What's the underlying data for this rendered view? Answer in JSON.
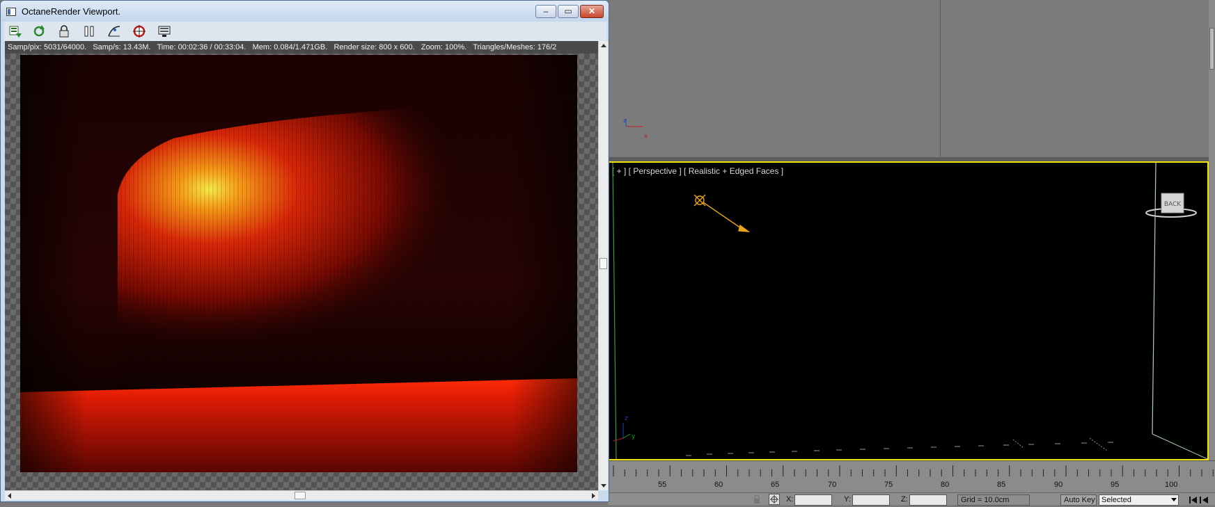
{
  "octane_window": {
    "title": "OctaneRender Viewport.",
    "caption_buttons": {
      "minimize": "–",
      "maximize": "▭",
      "close": "✕"
    },
    "toolbar_icons": [
      "export-icon",
      "refresh-icon",
      "lock-icon",
      "pause-icon",
      "settings-curve-icon",
      "focus-picker-icon",
      "monitor-icon"
    ],
    "stats": {
      "samp_pix": "Samp/pix: 5031/64000.",
      "samp_s": "Samp/s: 13.43M.",
      "time": "Time: 00:02:36 / 00:33:04.",
      "mem": "Mem: 0.084/1.471GB.",
      "render_size": "Render size: 800 x 600.",
      "zoom": "Zoom: 100%.",
      "triangles": "Triangles/Meshes: 176/2"
    }
  },
  "max_viewport": {
    "perspective_label": "[ + ] [ Perspective ] [ Realistic + Edged Faces ]",
    "viewcube_label": "BACK",
    "axis_top": {
      "z": "z",
      "x": "x"
    },
    "axis_persp": {
      "z": "z",
      "y": "y"
    },
    "accent_color": "#f2e600"
  },
  "timeline": {
    "ticks": [
      "55",
      "60",
      "65",
      "70",
      "75",
      "80",
      "85",
      "90",
      "95",
      "100"
    ]
  },
  "statusbar": {
    "x_label": "X:",
    "y_label": "Y:",
    "z_label": "Z:",
    "grid": "Grid = 10.0cm",
    "auto_key": "Auto Key",
    "selected": "Selected"
  }
}
